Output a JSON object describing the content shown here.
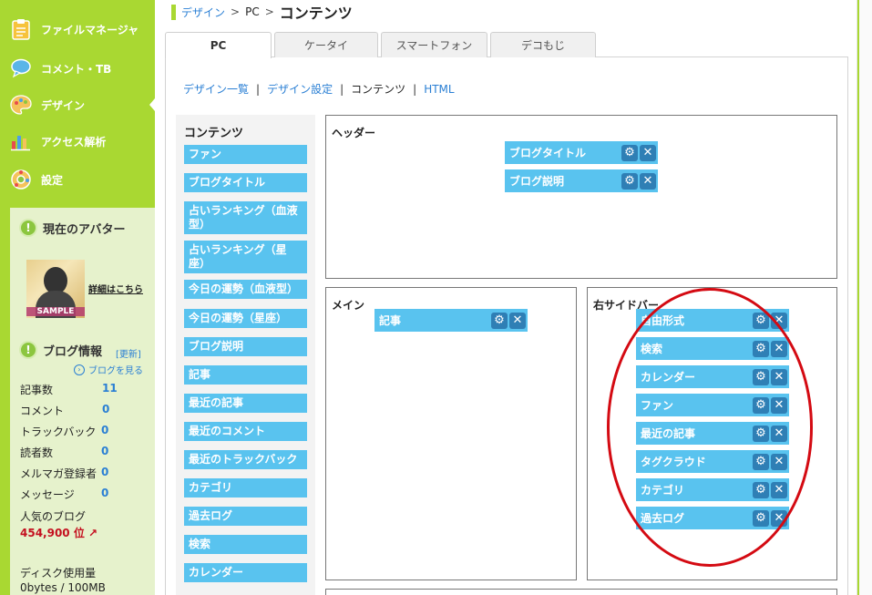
{
  "sidebar": {
    "items": [
      {
        "label": "ファイルマネージャ",
        "icon": "clipboard-icon"
      },
      {
        "label": "コメント・TB",
        "icon": "speech-bubble-icon"
      },
      {
        "label": "デザイン",
        "icon": "palette-icon"
      },
      {
        "label": "アクセス解析",
        "icon": "bar-chart-icon"
      },
      {
        "label": "設定",
        "icon": "gear-icon"
      }
    ],
    "avatar": {
      "title": "現在のアバター",
      "sample": "SAMPLE",
      "detail_link": "詳細はこちら"
    },
    "blog_info": {
      "title": "ブログ情報",
      "refresh": "[更新]",
      "view_blog": "ブログを見る",
      "stats": [
        {
          "label": "記事数",
          "value": "11"
        },
        {
          "label": "コメント",
          "value": "0"
        },
        {
          "label": "トラックバック",
          "value": "0"
        },
        {
          "label": "読者数",
          "value": "0"
        },
        {
          "label": "メルマガ登録者",
          "value": "0"
        },
        {
          "label": "メッセージ",
          "value": "0"
        }
      ],
      "rank_label": "人気のブログ",
      "rank_value": "454,900 位",
      "disk_label": "ディスク使用量",
      "disk_value": "0bytes / 100MB"
    }
  },
  "breadcrumb": {
    "items": [
      "デザイン",
      "PC"
    ],
    "separator": ">",
    "current": "コンテンツ"
  },
  "tabs": [
    "PC",
    "ケータイ",
    "スマートフォン",
    "デコもじ"
  ],
  "subnav": {
    "items": [
      "デザイン一覧",
      "デザイン設定",
      "コンテンツ",
      "HTML"
    ],
    "separator": "|"
  },
  "contents_list": {
    "title": "コンテンツ",
    "items": [
      "ファン",
      "ブログタイトル",
      "占いランキング（血液型）",
      "占いランキング（星座）",
      "今日の運勢（血液型）",
      "今日の運勢（星座）",
      "ブログ説明",
      "記事",
      "最近の記事",
      "最近のコメント",
      "最近のトラックバック",
      "カテゴリ",
      "過去ログ",
      "検索",
      "カレンダー"
    ]
  },
  "zones": {
    "header": {
      "title": "ヘッダー",
      "widgets": [
        "ブログタイトル",
        "ブログ説明"
      ]
    },
    "main": {
      "title": "メイン",
      "widgets": [
        "記事"
      ]
    },
    "right_sidebar": {
      "title": "右サイドバー",
      "widgets": [
        "自由形式",
        "検索",
        "カレンダー",
        "ファン",
        "最近の記事",
        "タグクラウド",
        "カテゴリ",
        "過去ログ"
      ]
    }
  },
  "colors": {
    "sidebar": "#a9d832",
    "widget": "#59c3ef",
    "link": "#2a7fd4",
    "highlight": "#d40a12"
  }
}
